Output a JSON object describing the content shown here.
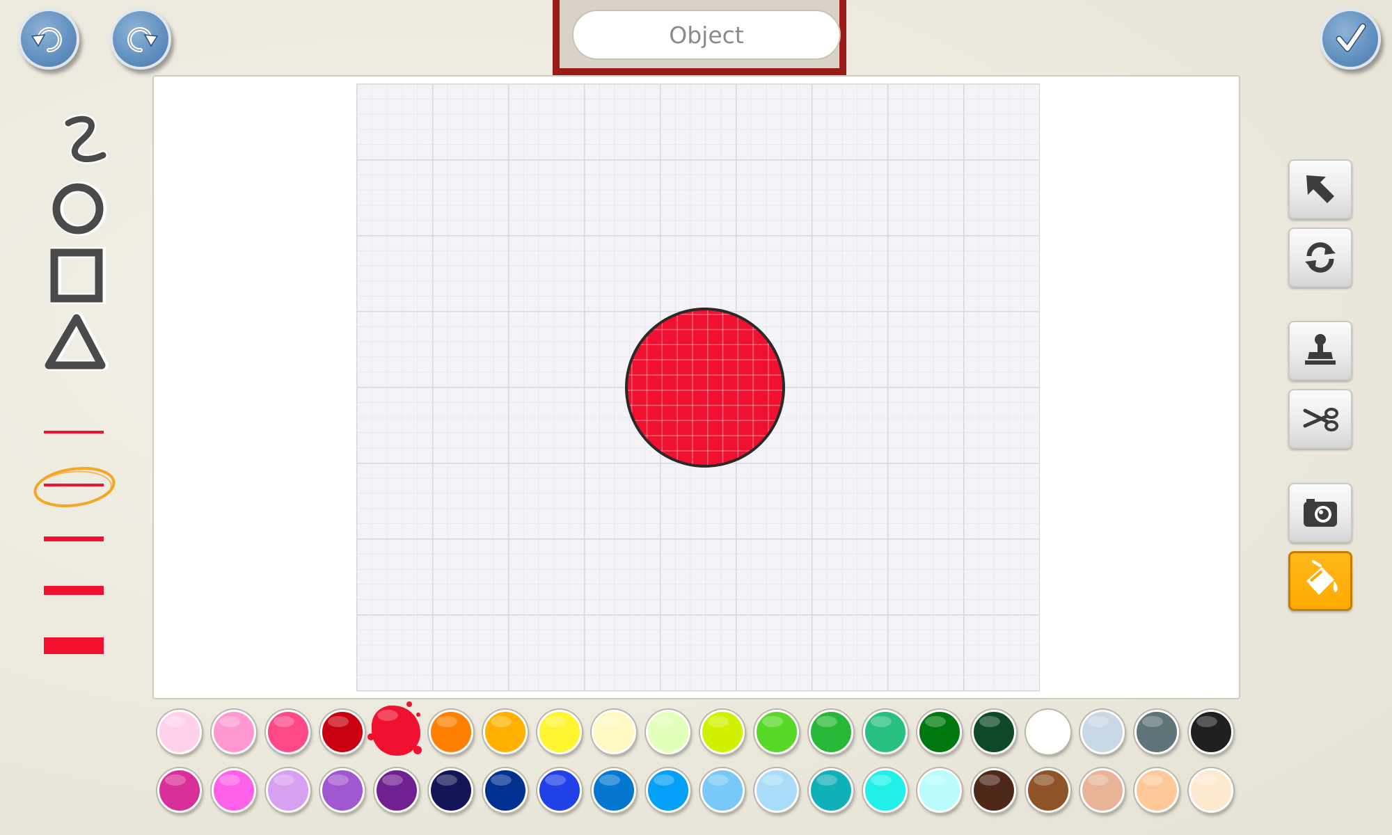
{
  "header": {
    "title_placeholder": "Object"
  },
  "icons": {
    "undo": "undo-icon",
    "redo": "redo-icon",
    "done": "checkmark-icon"
  },
  "colors": {
    "accent_frame": "#9b1a1a",
    "button_blue": "#5f8fbf",
    "active_tool": "#ffaa00",
    "selected_ring": "#f5a623",
    "current_color": "#f01030"
  },
  "left_tools": {
    "shapes": [
      "freehand-tool",
      "circle-tool",
      "rectangle-tool",
      "triangle-tool"
    ],
    "line_widths": [
      "thin",
      "small",
      "medium",
      "large",
      "extra-large"
    ],
    "selected_line_width": "small"
  },
  "right_tools": {
    "items": [
      "select-tool",
      "rotate-tool",
      "stamp-tool",
      "cut-tool",
      "camera-tool",
      "fill-tool"
    ],
    "active": "fill-tool"
  },
  "palette": {
    "row1": [
      "#ffd0ea",
      "#ff98d0",
      "#ff4888",
      "#c80010",
      "#f01030",
      "#ff8000",
      "#ffb000",
      "#fff430",
      "#fff8c0",
      "#e0ffb8",
      "#d0f000",
      "#58d828",
      "#28b838",
      "#28c080",
      "#007810",
      "#0e4a28",
      "#ffffff",
      "#c8d8e4",
      "#5e7478",
      "#202020"
    ],
    "row2": [
      "#d83098",
      "#ff60e8",
      "#d8a0f0",
      "#a058d0",
      "#702090",
      "#141458",
      "#003090",
      "#2040e8",
      "#0478d0",
      "#04a0f8",
      "#78c8f8",
      "#a8dcf8",
      "#10b0b8",
      "#20f0e8",
      "#b8fcfc",
      "#4e2818",
      "#8e5428",
      "#e8b498",
      "#ffc898",
      "#fee8d0"
    ],
    "selected_index": 4
  }
}
